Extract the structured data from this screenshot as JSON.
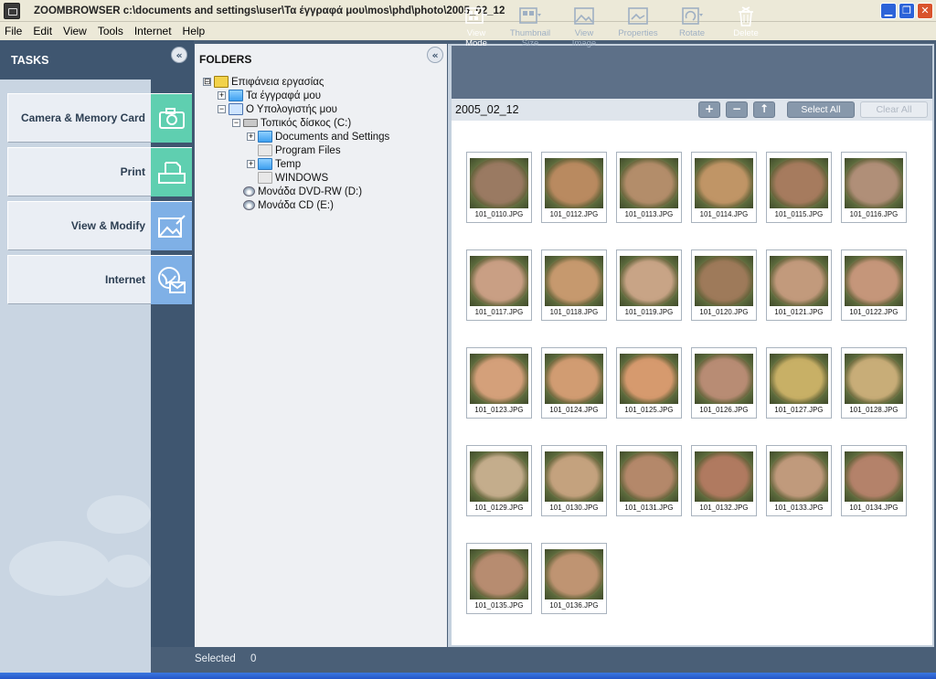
{
  "window": {
    "title": "ZOOMBROWSER c:\\documents and settings\\user\\Τα έγγραφά μου\\mos\\phd\\photo\\2005_02_12",
    "minimize": "▁",
    "maximize": "❐",
    "close": "✕"
  },
  "menu": [
    "File",
    "Edit",
    "View",
    "Tools",
    "Internet",
    "Help"
  ],
  "tasks": {
    "title": "TASKS",
    "collapse": "«",
    "items": [
      {
        "label": "Camera & Memory Card",
        "icon": "camera-icon",
        "color": "#5fcfb0"
      },
      {
        "label": "Print",
        "icon": "printer-icon",
        "color": "#5fcfb0"
      },
      {
        "label": "View & Modify",
        "icon": "image-edit-icon",
        "color": "#7fb0e6"
      },
      {
        "label": "Internet",
        "icon": "globe-mail-icon",
        "color": "#7fb0e6"
      }
    ]
  },
  "folders": {
    "title": "FOLDERS",
    "collapse": "«",
    "tree": [
      {
        "label": "Επιφάνεια εργασίας",
        "toggle": "⊟",
        "icon": "desktop"
      },
      {
        "label": "Τα έγγραφά μου",
        "toggle": "+",
        "icon": "folder"
      },
      {
        "label": "Ο Υπολογιστής μου",
        "toggle": "−",
        "icon": "computer"
      },
      {
        "label": "Τοπικός δίσκος (C:)",
        "toggle": "−",
        "icon": "disk"
      },
      {
        "label": "Documents and Settings",
        "toggle": "+",
        "icon": "folder"
      },
      {
        "label": "Program Files",
        "toggle": "",
        "icon": "folder-plain"
      },
      {
        "label": "Temp",
        "toggle": "+",
        "icon": "folder"
      },
      {
        "label": "WINDOWS",
        "toggle": "",
        "icon": "folder-plain"
      },
      {
        "label": "Μονάδα DVD-RW (D:)",
        "toggle": "",
        "icon": "cd"
      },
      {
        "label": "Μονάδα CD (E:)",
        "toggle": "",
        "icon": "cd"
      }
    ]
  },
  "toolbar": {
    "buttons": [
      {
        "line1": "View",
        "line2": "Mode",
        "enabled": true
      },
      {
        "line1": "Thumbnail",
        "line2": "Size",
        "enabled": false
      },
      {
        "line1": "View",
        "line2": "Image",
        "enabled": false
      },
      {
        "line1": "Properties",
        "line2": "",
        "enabled": false
      },
      {
        "line1": "Rotate",
        "line2": "",
        "enabled": false
      },
      {
        "line1": "Delete",
        "line2": "",
        "enabled": true
      }
    ],
    "zoom_in": "+",
    "zoom_out": "−",
    "up": "↑",
    "select_all": "Select All",
    "clear_all": "Clear All"
  },
  "viewer": {
    "path": "2005_02_12",
    "thumbnails": [
      {
        "name": "101_0110.JPG",
        "tone": "#9a7a62"
      },
      {
        "name": "101_0112.JPG",
        "tone": "#b98a60"
      },
      {
        "name": "101_0113.JPG",
        "tone": "#b38d6a"
      },
      {
        "name": "101_0114.JPG",
        "tone": "#c09566"
      },
      {
        "name": "101_0115.JPG",
        "tone": "#a67b5e"
      },
      {
        "name": "101_0116.JPG",
        "tone": "#b08f78"
      },
      {
        "name": "101_0117.JPG",
        "tone": "#c99f84"
      },
      {
        "name": "101_0118.JPG",
        "tone": "#c6996e"
      },
      {
        "name": "101_0119.JPG",
        "tone": "#c8a486"
      },
      {
        "name": "101_0120.JPG",
        "tone": "#9e7a5a"
      },
      {
        "name": "101_0121.JPG",
        "tone": "#c29a7c"
      },
      {
        "name": "101_0122.JPG",
        "tone": "#c5967a"
      },
      {
        "name": "101_0123.JPG",
        "tone": "#d4a07a"
      },
      {
        "name": "101_0124.JPG",
        "tone": "#d19c72"
      },
      {
        "name": "101_0125.JPG",
        "tone": "#d69a6e"
      },
      {
        "name": "101_0126.JPG",
        "tone": "#b88c74"
      },
      {
        "name": "101_0127.JPG",
        "tone": "#c8b066"
      },
      {
        "name": "101_0128.JPG",
        "tone": "#c8ad78"
      },
      {
        "name": "101_0129.JPG",
        "tone": "#c4ad8c"
      },
      {
        "name": "101_0130.JPG",
        "tone": "#c4a27e"
      },
      {
        "name": "101_0131.JPG",
        "tone": "#b4886a"
      },
      {
        "name": "101_0132.JPG",
        "tone": "#b07a60"
      },
      {
        "name": "101_0133.JPG",
        "tone": "#c09a7c"
      },
      {
        "name": "101_0134.JPG",
        "tone": "#b4826a"
      },
      {
        "name": "101_0135.JPG",
        "tone": "#b78c70"
      },
      {
        "name": "101_0136.JPG",
        "tone": "#bf9472"
      }
    ]
  },
  "status": {
    "label": "Selected",
    "count": "0"
  }
}
